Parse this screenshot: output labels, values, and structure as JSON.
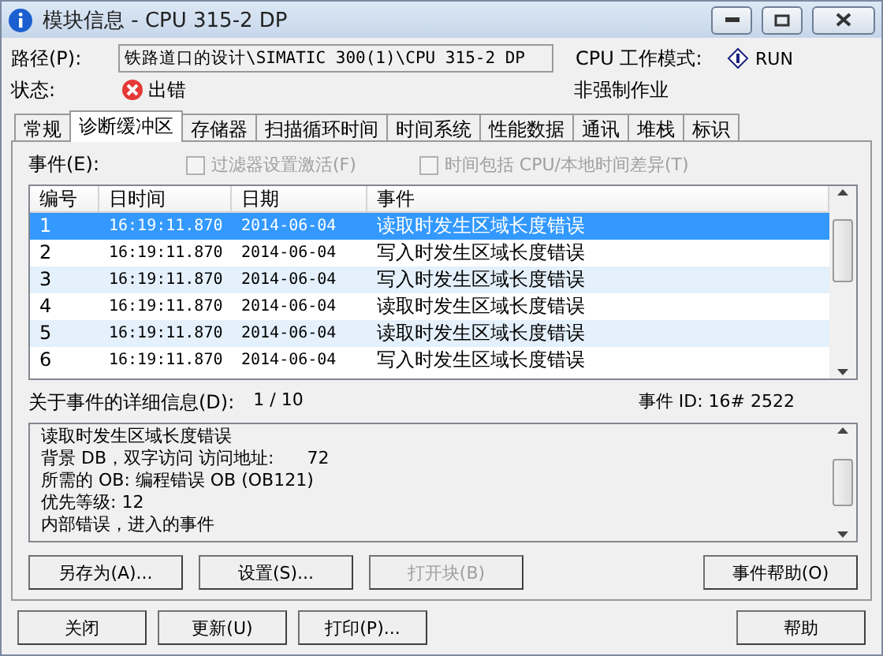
{
  "window": {
    "title": "模块信息 - CPU 315-2 DP"
  },
  "path": {
    "label": "路径(P):",
    "value": "铁路道口的设计\\SIMATIC 300(1)\\CPU 315-2 DP"
  },
  "mode": {
    "label": "CPU 工作模式:",
    "value": "RUN",
    "forcing": "非强制作业"
  },
  "status": {
    "label": "状态:",
    "value": "出错"
  },
  "tabs": [
    {
      "label": "常规",
      "selected": false
    },
    {
      "label": "诊断缓冲区",
      "selected": true
    },
    {
      "label": "存储器",
      "selected": false
    },
    {
      "label": "扫描循环时间",
      "selected": false
    },
    {
      "label": "时间系统",
      "selected": false
    },
    {
      "label": "性能数据",
      "selected": false
    },
    {
      "label": "通讯",
      "selected": false
    },
    {
      "label": "堆栈",
      "selected": false
    },
    {
      "label": "标识",
      "selected": false
    }
  ],
  "events_label": "事件(E):",
  "options": [
    {
      "label": "过滤器设置激活(F)",
      "checked": false,
      "disabled": true
    },
    {
      "label": "时间包括 CPU/本地时间差异(T)",
      "checked": false,
      "disabled": true
    }
  ],
  "table": {
    "columns": [
      "编号",
      "日时间",
      "日期",
      "事件"
    ],
    "rows": [
      {
        "cells": [
          "1",
          "16:19:11.870",
          "2014-06-04",
          "读取时发生区域长度错误"
        ],
        "selected": true
      },
      {
        "cells": [
          "2",
          "16:19:11.870",
          "2014-06-04",
          "写入时发生区域长度错误"
        ],
        "selected": false
      },
      {
        "cells": [
          "3",
          "16:19:11.870",
          "2014-06-04",
          "写入时发生区域长度错误"
        ],
        "selected": false
      },
      {
        "cells": [
          "4",
          "16:19:11.870",
          "2014-06-04",
          "读取时发生区域长度错误"
        ],
        "selected": false
      },
      {
        "cells": [
          "5",
          "16:19:11.870",
          "2014-06-04",
          "读取时发生区域长度错误"
        ],
        "selected": false
      },
      {
        "cells": [
          "6",
          "16:19:11.870",
          "2014-06-04",
          "写入时发生区域长度错误"
        ],
        "selected": false
      }
    ]
  },
  "details": {
    "label": "关于事件的详细信息(D):",
    "counter": "1 / 10",
    "event_id": "事件 ID: 16# 2522",
    "lines": [
      "读取时发生区域长度错误",
      "背景 DB，双字访问 访问地址:      72",
      "所需的 OB: 编程错误 OB (OB121)",
      "优先等级: 12",
      "内部错误，进入的事件"
    ]
  },
  "panel_buttons": [
    {
      "label": "另存为(A)...",
      "disabled": false
    },
    {
      "label": "设置(S)...",
      "disabled": false
    },
    {
      "label": "打开块(B)",
      "disabled": true
    },
    {
      "label": "事件帮助(O)",
      "disabled": false
    }
  ],
  "buttons": [
    {
      "label": "关闭"
    },
    {
      "label": "更新(U)"
    },
    {
      "label": "打印(P)..."
    },
    {
      "label": "帮助"
    }
  ]
}
